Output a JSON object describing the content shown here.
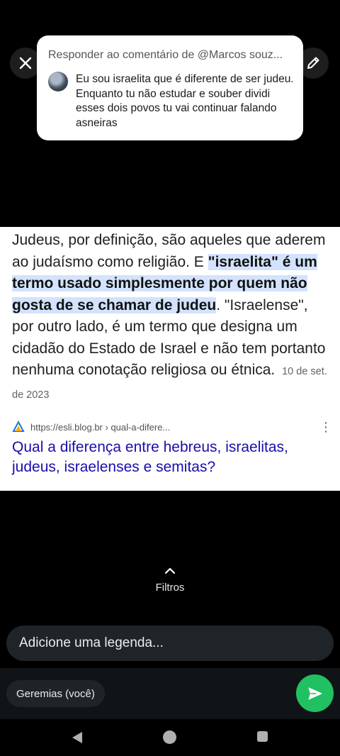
{
  "reply": {
    "header": "Responder ao comentário de @Marcos souz...",
    "comment": "Eu sou israelita que é diferente de ser judeu. Enquanto tu não estudar e souber dividi esses dois povos tu vai continuar falando asneiras"
  },
  "screenshot": {
    "snippet_before": "Judeus, por definição, são aqueles que aderem ao judaísmo como religião. E ",
    "snippet_highlight": "\"israelita\" é um termo usado simplesmente por quem não gosta de se chamar de judeu",
    "snippet_after": ". \"Israelense\", por outro lado, é um termo que designa um cidadão do Estado de Israel e não tem portanto nenhuma conotação religiosa ou étnica.",
    "date": "10 de set. de 2023",
    "source_url": "https://esli.blog.br › qual-a-difere...",
    "result_title": "Qual a diferença entre hebreus, israelitas, judeus, israelenses e semitas?"
  },
  "filters": {
    "label": "Filtros"
  },
  "caption": {
    "placeholder": "Adicione uma legenda..."
  },
  "recipient": {
    "label": "Geremias (você)"
  },
  "colors": {
    "send_green": "#21c063",
    "highlight": "#d3e3fd",
    "link_blue": "#1a0dab"
  },
  "icons": [
    "close-icon",
    "pencil-icon",
    "chevron-up-icon",
    "send-icon",
    "back-icon",
    "home-icon",
    "recents-icon",
    "blog-favicon-icon",
    "more-vert-icon"
  ]
}
